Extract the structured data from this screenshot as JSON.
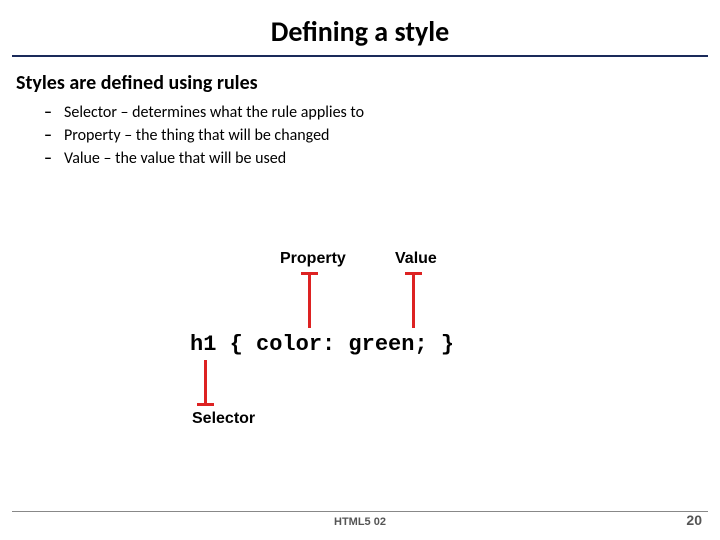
{
  "title": "Defining a style",
  "subheading": "Styles are defined using rules",
  "bullets": [
    "Selector – determines what the rule applies to",
    "Property – the thing that will be changed",
    "Value – the value that will be used"
  ],
  "diagram": {
    "label_property": "Property",
    "label_value": "Value",
    "label_selector": "Selector",
    "code": "h1 { color: green; }"
  },
  "footer": "HTML5 02",
  "page_number": "20"
}
